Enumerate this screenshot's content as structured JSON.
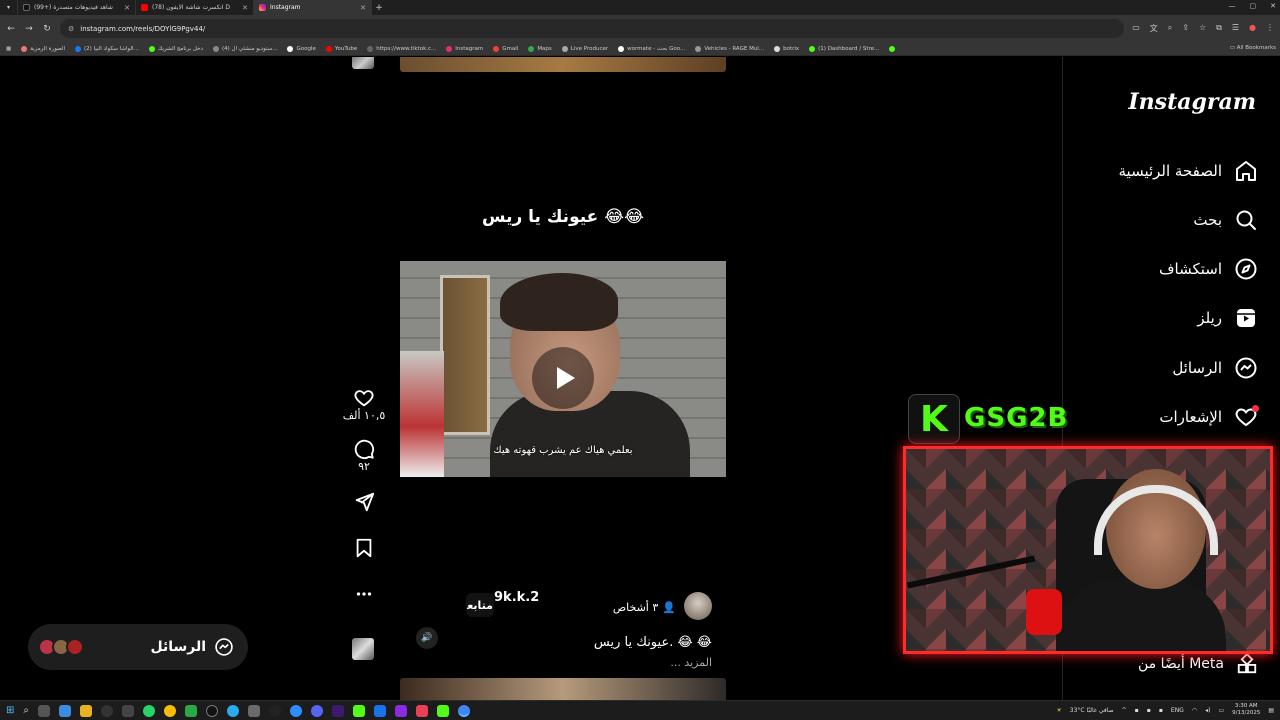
{
  "browser": {
    "tabs": [
      {
        "label": "(99+) شاهد فيديوهات متصدرة",
        "active": false
      },
      {
        "label": "(78) انكسرت شاشة الايفون D",
        "active": false
      },
      {
        "label": "Instagram",
        "active": true
      }
    ],
    "new_tab": "+",
    "url": "instagram.com/reels/DOYlG9Pgv44/",
    "bookmarks": [
      "الصورة الرمزية",
      "(2) الواشا سكواد البيا...",
      "دخل برنامج الشريك",
      "(4) ستوديو منشئي ال...",
      "Google",
      "YouTube",
      "https://www.tiktok.c...",
      "Instagram",
      "Gmail",
      "Maps",
      "Live Producer",
      "wormate - بحث Goo...",
      "Vehicles - RAGE Mul...",
      "botrix",
      "(1) Dashboard / Stre..."
    ],
    "all_bookmarks": "All Bookmarks"
  },
  "reel": {
    "caption_top": "عيونك يا ريس 😂😂",
    "subtitle": "بعلمي هياك عم يشرب قهوته هيك",
    "likes": "١٠,٥ ألف",
    "comments": "٩٢",
    "username": "9k.k.2",
    "follow": "متابعة",
    "people": "٣ أشخاص",
    "caption": "عيونك يا ريس. 😂 😂",
    "more": "... المزيد"
  },
  "messages_pill": {
    "label": "الرسائل"
  },
  "sidebar": {
    "logo": "Instagram",
    "items": [
      {
        "label": "الصفحة الرئيسية",
        "icon": "home-icon"
      },
      {
        "label": "بحث",
        "icon": "search-icon"
      },
      {
        "label": "استكشاف",
        "icon": "compass-icon"
      },
      {
        "label": "ريلز",
        "icon": "reels-icon"
      },
      {
        "label": "الرسائل",
        "icon": "messenger-icon"
      },
      {
        "label": "الإشعارات",
        "icon": "heart-icon"
      }
    ],
    "also_from": "أيضًا من Meta"
  },
  "stream_overlay": {
    "logo_letter": "K",
    "channel": "GSG2B",
    "brand_color": "#53fc18",
    "frame_color": "#ff2a2a"
  },
  "taskbar": {
    "weather": "33°C صافي غالبًا",
    "lang": "ENG",
    "time": "3:30 AM",
    "date": "9/13/2025"
  }
}
